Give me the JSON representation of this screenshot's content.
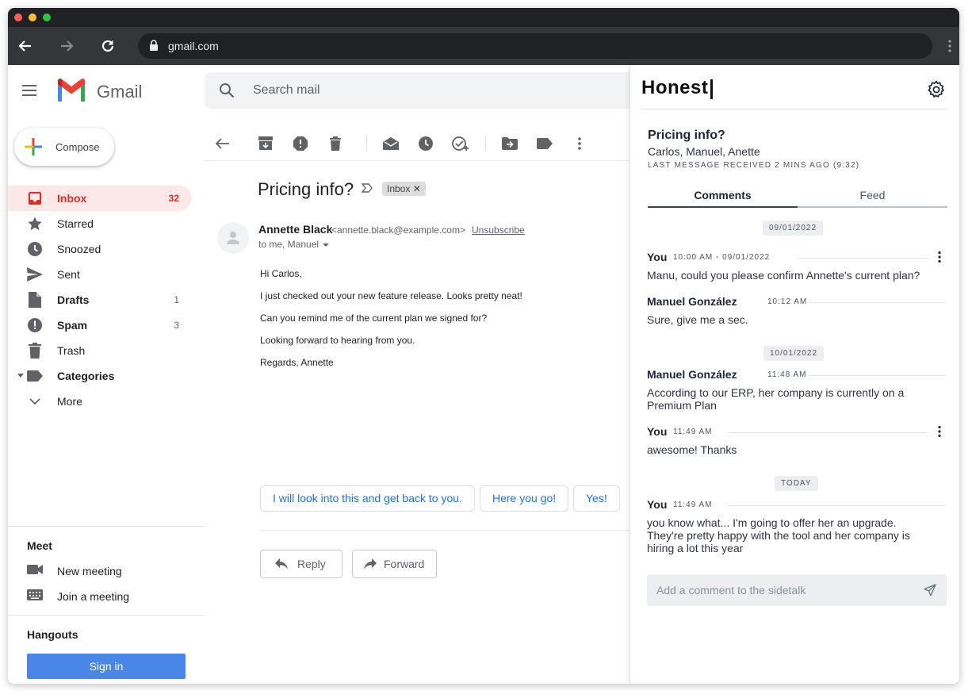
{
  "browser": {
    "url": "gmail.com",
    "traffic_colors": [
      "#ff5f57",
      "#febc2e",
      "#28c840"
    ]
  },
  "gmail": {
    "brand": "Gmail",
    "search_placeholder": "Search mail",
    "compose_label": "Compose",
    "nav": [
      {
        "label": "Inbox",
        "count": "32",
        "icon": "inbox-icon"
      },
      {
        "label": "Starred",
        "count": "",
        "icon": "star-icon"
      },
      {
        "label": "Snoozed",
        "count": "",
        "icon": "clock-icon"
      },
      {
        "label": "Sent",
        "count": "",
        "icon": "send-icon"
      },
      {
        "label": "Drafts",
        "count": "1",
        "icon": "draft-icon"
      },
      {
        "label": "Spam",
        "count": "3",
        "icon": "spam-icon"
      },
      {
        "label": "Trash",
        "count": "",
        "icon": "trash-icon"
      },
      {
        "label": "Categories",
        "count": "",
        "icon": "label-icon"
      },
      {
        "label": "More",
        "count": "",
        "icon": "chevron-down-icon"
      }
    ],
    "meet": {
      "title": "Meet",
      "new_meeting": "New meeting",
      "join_meeting": "Join a meeting"
    },
    "hangouts": {
      "title": "Hangouts",
      "sign_in": "Sign in"
    }
  },
  "email": {
    "subject": "Pricing info?",
    "label_chip": "Inbox",
    "sender_name": "Annette Black",
    "sender_email": "<annette.black@example.com>",
    "unsubscribe": "Unsubscribe",
    "to_line": "to me, Manuel",
    "body": [
      "Hi Carlos,",
      "I just checked out your new feature release. Looks pretty neat!",
      "Can you remind me of the current plan we signed for?",
      "Looking forward to hearing from you.",
      "Regards, Annette"
    ],
    "smart_replies": [
      "I will look into this and get back to you.",
      "Here you go!",
      "Yes!"
    ],
    "reply_label": "Reply",
    "forward_label": "Forward"
  },
  "honest": {
    "brand": "Honest",
    "subject": "Pricing info?",
    "participants": "Carlos, Manuel, Anette",
    "last_message": "LAST MESSAGE RECEIVED 2 MINS AGO (9:32)",
    "tabs": [
      "Comments",
      "Feed"
    ],
    "dates": [
      "09/01/2022",
      "10/01/2022",
      "TODAY"
    ],
    "comments": [
      {
        "author": "You",
        "time": "10:00 AM - 09/01/2022",
        "text": "Manu, could you please confirm Annette's current plan?"
      },
      {
        "author": "Manuel González",
        "time": "10:12 AM",
        "text": "Sure, give me a sec."
      },
      {
        "author": "Manuel González",
        "time": "11:48 AM",
        "text": "According to our ERP, her company is currently on a Premium Plan"
      },
      {
        "author": "You",
        "time": "11:49 AM",
        "text": "awesome! Thanks"
      },
      {
        "author": "You",
        "time": "11:49 AM",
        "text": "you know what... I'm going to offer her an upgrade. They're pretty happy with the tool and her company is hiring a lot this year"
      }
    ],
    "comment_placeholder": "Add a comment to the sidetalk"
  }
}
